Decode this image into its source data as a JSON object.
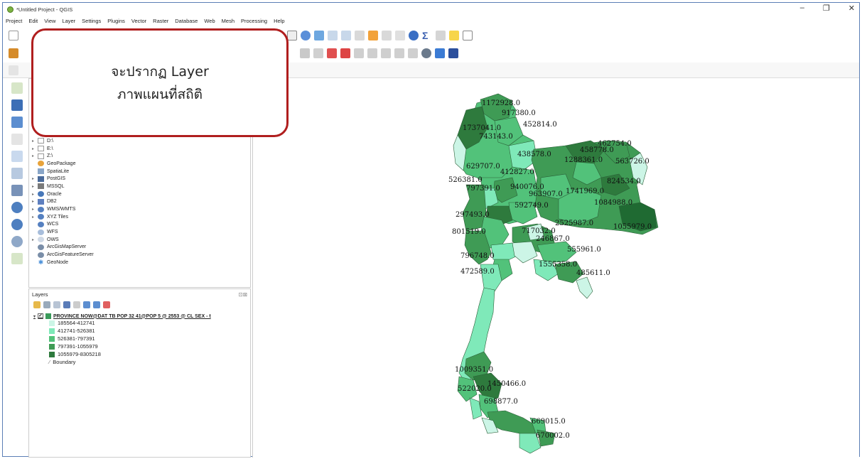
{
  "window": {
    "title": "*Untitled Project - QGIS",
    "controls": [
      "–",
      "❐",
      "✕"
    ]
  },
  "menu": [
    "Project",
    "Edit",
    "View",
    "Layer",
    "Settings",
    "Plugins",
    "Vector",
    "Raster",
    "Database",
    "Web",
    "Mesh",
    "Processing",
    "Help"
  ],
  "callout": {
    "line1": "จะปรากฏ Layer",
    "line2": "ภาพแผนที่สถิติ"
  },
  "browser": {
    "items": [
      {
        "label": "D:\\",
        "icon": "folder-icon"
      },
      {
        "label": "E:\\",
        "icon": "folder-icon"
      },
      {
        "label": "Z:\\",
        "icon": "folder-icon"
      },
      {
        "label": "GeoPackage",
        "icon": "geopackage-icon"
      },
      {
        "label": "SpatiaLite",
        "icon": "spatialite-icon"
      },
      {
        "label": "PostGIS",
        "icon": "postgis-icon"
      },
      {
        "label": "MSSQL",
        "icon": "mssql-icon"
      },
      {
        "label": "Oracle",
        "icon": "oracle-icon"
      },
      {
        "label": "DB2",
        "icon": "db2-icon"
      },
      {
        "label": "WMS/WMTS",
        "icon": "wms-icon"
      },
      {
        "label": "XYZ Tiles",
        "icon": "xyz-icon"
      },
      {
        "label": "WCS",
        "icon": "wcs-icon"
      },
      {
        "label": "WFS",
        "icon": "wfs-icon"
      },
      {
        "label": "OWS",
        "icon": "ows-icon"
      },
      {
        "label": "ArcGisMapServer",
        "icon": "arcgis-map-icon"
      },
      {
        "label": "ArcGisFeatureServer",
        "icon": "arcgis-feature-icon"
      },
      {
        "label": "GeoNode",
        "icon": "geonode-icon"
      }
    ]
  },
  "layers": {
    "title": "Layers",
    "layer_name": "PROVINCE NOW@DAT TB POP 32 41@POP 5 @ 2553 @ CL SEX - t",
    "classes": [
      {
        "label": "185564-412741",
        "color": "#ccf5e6"
      },
      {
        "label": "412741-526381",
        "color": "#7fe9b9"
      },
      {
        "label": "526381-797391",
        "color": "#52c27a"
      },
      {
        "label": "797391-1055979",
        "color": "#3f9b55"
      },
      {
        "label": "1055979-8305218",
        "color": "#2e7a3d"
      }
    ],
    "boundary_label": "Boundary"
  },
  "map_labels": [
    "1172928.0",
    "917380.0",
    "1737041.0",
    "452814.0",
    "743143.0",
    "462754.0",
    "458778.0",
    "438578.0",
    "1288361.0",
    "563726.0",
    "629707.0",
    "412827.0",
    "526381.0",
    "824534.0",
    "797391.0",
    "940076.0",
    "1741969.0",
    "963907.0",
    "1084988.0",
    "592749.0",
    "297493.0",
    "2525987.0",
    "801519.0",
    "1055979.0",
    "717032.0",
    "246867.0",
    "555961.0",
    "796748.0",
    "1555358.0",
    "472589.0",
    "485611.0",
    "1009351.0",
    "1450466.0",
    "522020.0",
    "698877.0",
    "669015.0",
    "670002.0"
  ]
}
